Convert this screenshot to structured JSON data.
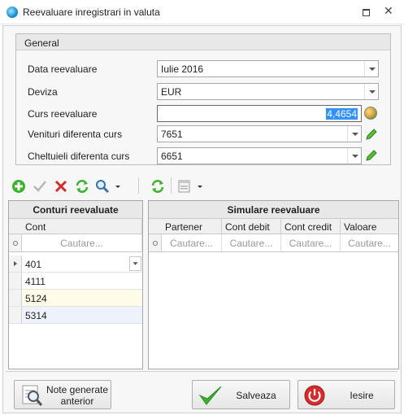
{
  "window": {
    "title": "Reevaluare inregistrari in valuta",
    "restore_icon": "restore-icon",
    "close_glyph": "✕"
  },
  "general": {
    "title": "General",
    "fields": [
      {
        "label": "Data reevaluare",
        "value": "Iulie 2016"
      },
      {
        "label": "Deviza",
        "value": "EUR"
      },
      {
        "label": "Curs reevaluare",
        "value": "4,4654"
      },
      {
        "label": "Venituri diferenta curs",
        "value": "7651"
      },
      {
        "label": "Cheltuieli diferenta curs",
        "value": "6651"
      }
    ]
  },
  "left_grid": {
    "title": "Conturi reevaluate",
    "column": "Cont",
    "filter_placeholder": "Cautare...",
    "rows": [
      "401",
      "4111",
      "5124",
      "5314"
    ]
  },
  "right_grid": {
    "title": "Simulare reevaluare",
    "columns": [
      "Partener",
      "Cont debit",
      "Cont credit",
      "Valoare"
    ],
    "filter_placeholders": [
      "Cautare...",
      "Cautare...",
      "Cautare...",
      "Cautare..."
    ]
  },
  "buttons": {
    "notes": "Note generate\nanterior",
    "save": "Salveaza",
    "exit": "Iesire"
  },
  "colors": {
    "accent_selection": "#3390ff",
    "save_check": "#3cb32e",
    "exit_red": "#d62b2b"
  }
}
